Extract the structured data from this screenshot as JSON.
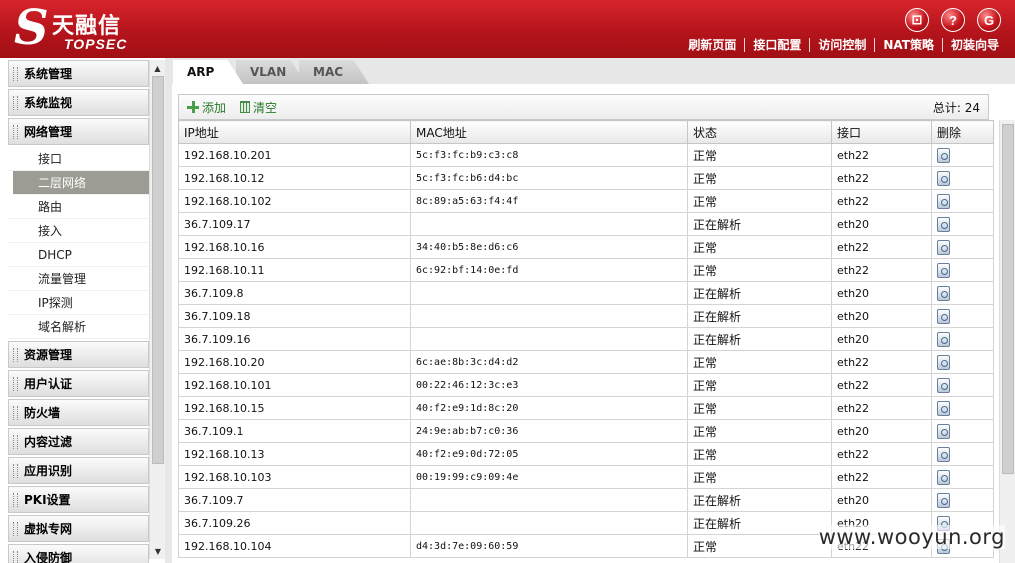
{
  "brand": {
    "logo_cn": "天融信",
    "logo_en": "TOPSEC",
    "logo_mark": "S"
  },
  "header": {
    "icons": [
      {
        "name": "save-icon",
        "glyph": "⊡"
      },
      {
        "name": "help-icon",
        "glyph": "?"
      },
      {
        "name": "logout-icon",
        "glyph": "G"
      }
    ],
    "nav": [
      "刷新页面",
      "接口配置",
      "访问控制",
      "NAT策略",
      "初装向导"
    ]
  },
  "sidebar": {
    "groups_top": [
      "系统管理",
      "系统监视"
    ],
    "active_group": "网络管理",
    "sub_items": [
      "接口",
      "二层网络",
      "路由",
      "接入",
      "DHCP",
      "流量管理",
      "IP探测",
      "域名解析"
    ],
    "active_sub": "二层网络",
    "groups_bottom": [
      "资源管理",
      "用户认证",
      "防火墙",
      "内容过滤",
      "应用识别",
      "PKI设置",
      "虚拟专网",
      "入侵防御"
    ]
  },
  "tabs": [
    "ARP",
    "VLAN",
    "MAC"
  ],
  "toolbar": {
    "add_label": "添加",
    "clear_label": "清空",
    "total_label": "总计: 24"
  },
  "table": {
    "columns": [
      "IP地址",
      "MAC地址",
      "状态",
      "接口",
      "删除"
    ],
    "rows": [
      [
        "192.168.10.201",
        "5c:f3:fc:b9:c3:c8",
        "正常",
        "eth22"
      ],
      [
        "192.168.10.12",
        "5c:f3:fc:b6:d4:bc",
        "正常",
        "eth22"
      ],
      [
        "192.168.10.102",
        "8c:89:a5:63:f4:4f",
        "正常",
        "eth22"
      ],
      [
        "36.7.109.17",
        "",
        "正在解析",
        "eth20"
      ],
      [
        "192.168.10.16",
        "34:40:b5:8e:d6:c6",
        "正常",
        "eth22"
      ],
      [
        "192.168.10.11",
        "6c:92:bf:14:0e:fd",
        "正常",
        "eth22"
      ],
      [
        "36.7.109.8",
        "",
        "正在解析",
        "eth20"
      ],
      [
        "36.7.109.18",
        "",
        "正在解析",
        "eth20"
      ],
      [
        "36.7.109.16",
        "",
        "正在解析",
        "eth20"
      ],
      [
        "192.168.10.20",
        "6c:ae:8b:3c:d4:d2",
        "正常",
        "eth22"
      ],
      [
        "192.168.10.101",
        "00:22:46:12:3c:e3",
        "正常",
        "eth22"
      ],
      [
        "192.168.10.15",
        "40:f2:e9:1d:8c:20",
        "正常",
        "eth22"
      ],
      [
        "36.7.109.1",
        "24:9e:ab:b7:c0:36",
        "正常",
        "eth20"
      ],
      [
        "192.168.10.13",
        "40:f2:e9:0d:72:05",
        "正常",
        "eth22"
      ],
      [
        "192.168.10.103",
        "00:19:99:c9:09:4e",
        "正常",
        "eth22"
      ],
      [
        "36.7.109.7",
        "",
        "正在解析",
        "eth20"
      ],
      [
        "36.7.109.26",
        "",
        "正在解析",
        "eth20"
      ],
      [
        "192.168.10.104",
        "d4:3d:7e:09:60:59",
        "正常",
        "eth22"
      ]
    ]
  },
  "watermark": "www.wooyun.org"
}
